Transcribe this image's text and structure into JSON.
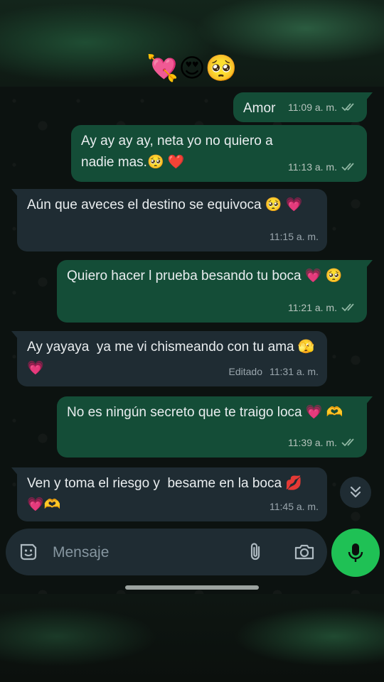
{
  "header_emoji": "💘😍🥺",
  "messages": [
    {
      "type": "out",
      "text": "Amor",
      "time": "11:09 a. m."
    },
    {
      "type": "out",
      "text": "Ay ay ay ay, neta yo no quiero a nadie mas.🥺 ❤️",
      "time": "11:13 a. m."
    },
    {
      "type": "in",
      "text": "Aún que aveces el destino se equivoca 🥺 💗",
      "time": "11:15 a. m."
    },
    {
      "type": "out",
      "text": "Quiero hacer l prueba besando tu boca 💗 🥺",
      "time": "11:21 a. m."
    },
    {
      "type": "in",
      "text": "Ay yayaya  ya me vi chismeando con tu ama 🫣💗",
      "time": "11:31 a. m.",
      "edited": "Editado"
    },
    {
      "type": "out",
      "text": "No es ningún secreto que te traigo loca 💗 🫶",
      "time": "11:39 a. m."
    },
    {
      "type": "in",
      "text": "Ven y toma el riesgo y  besame en la boca 💋💗🫶",
      "time": "11:45 a. m."
    }
  ],
  "composer": {
    "placeholder": "Mensaje"
  },
  "icons": {
    "sticker": "sticker-icon",
    "attach": "paperclip-icon",
    "camera": "camera-icon",
    "mic": "microphone-icon",
    "scroll": "double-chevron-down-icon",
    "read": "double-check-icon"
  },
  "colors": {
    "outgoing": "#144d37",
    "incoming": "#1f2c33",
    "accent": "#1fc155",
    "tick": "#8fb7a3"
  }
}
